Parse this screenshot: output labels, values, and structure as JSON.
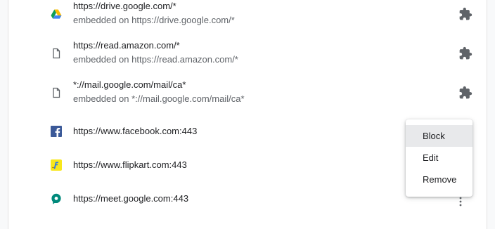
{
  "rows": [
    {
      "title": "https://drive.google.com/*",
      "subtitle": "embedded on https://drive.google.com/*",
      "icon": "google-drive-icon"
    },
    {
      "title": "https://read.amazon.com/*",
      "subtitle": "embedded on https://read.amazon.com/*",
      "icon": "page-icon"
    },
    {
      "title": "*://mail.google.com/mail/ca*",
      "subtitle": "embedded on *://mail.google.com/mail/ca*",
      "icon": "page-icon"
    },
    {
      "title": "https://www.facebook.com:443",
      "icon": "facebook-icon"
    },
    {
      "title": "https://www.flipkart.com:443",
      "icon": "flipkart-icon"
    },
    {
      "title": "https://meet.google.com:443",
      "icon": "google-meet-icon"
    }
  ],
  "menu": {
    "items": [
      "Block",
      "Edit",
      "Remove"
    ],
    "highlighted": "Block"
  },
  "colors": {
    "text_primary": "#202124",
    "text_secondary": "#5f6368",
    "icon_gray": "#5f6368",
    "facebook_blue": "#3b5998",
    "flipkart_yellow": "#f8e71c",
    "meet_green": "#00897b",
    "menu_highlight": "#e8e9eb"
  }
}
